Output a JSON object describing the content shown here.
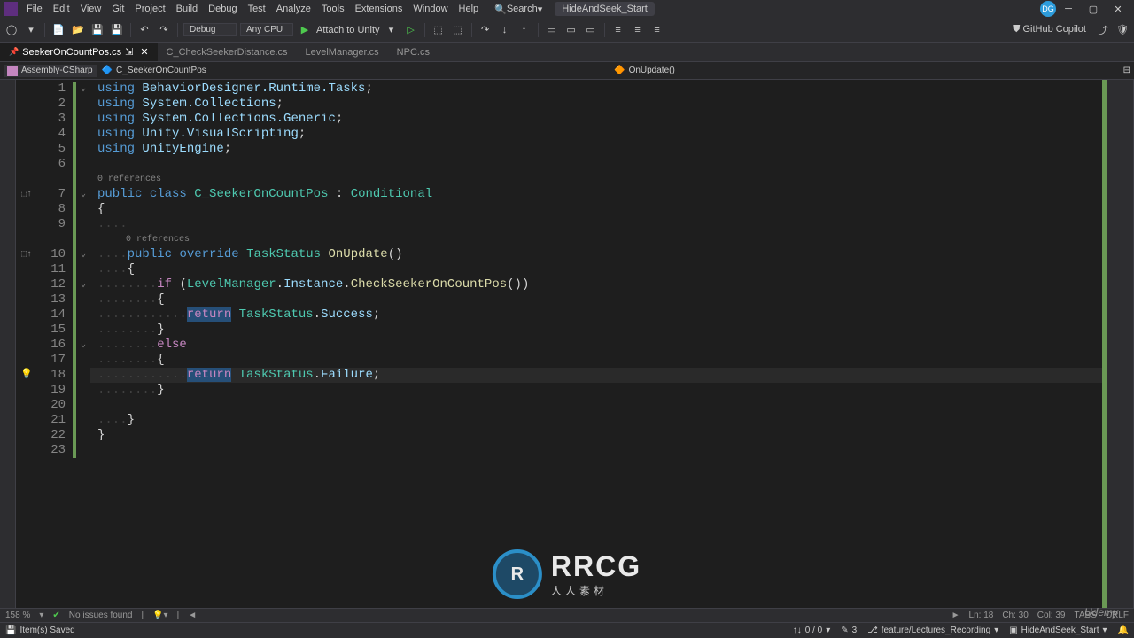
{
  "menu": {
    "items": [
      "File",
      "Edit",
      "View",
      "Git",
      "Project",
      "Build",
      "Debug",
      "Test",
      "Analyze",
      "Tools",
      "Extensions",
      "Window",
      "Help"
    ]
  },
  "search": {
    "label": "Search"
  },
  "solution": {
    "name": "HideAndSeek_Start"
  },
  "avatar": {
    "initials": "DG"
  },
  "toolbar": {
    "config": "Debug",
    "platform": "Any CPU",
    "attach": "Attach to Unity",
    "copilot": "GitHub Copilot"
  },
  "tabs": [
    {
      "name": "SeekerOnCountPos.cs",
      "active": true,
      "pinned": true
    },
    {
      "name": "C_CheckSeekerDistance.cs",
      "active": false,
      "pinned": false
    },
    {
      "name": "LevelManager.cs",
      "active": false,
      "pinned": false
    },
    {
      "name": "NPC.cs",
      "active": false,
      "pinned": false
    }
  ],
  "nav": {
    "assembly": "Assembly-CSharp",
    "type": "C_SeekerOnCountPos",
    "member": "OnUpdate()"
  },
  "codelens": {
    "l7": "0 references",
    "l10": "0 references"
  },
  "tokens": {
    "using": "using",
    "bd": "BehaviorDesigner.Runtime.Tasks",
    "sc": "System.Collections",
    "scg": "System.Collections.Generic",
    "uvs": "Unity.VisualScripting",
    "ue": "UnityEngine",
    "public": "public",
    "class": "class",
    "cls": "C_SeekerOnCountPos",
    "conditional": "Conditional",
    "override": "override",
    "taskstatus": "TaskStatus",
    "onupdate": "OnUpdate",
    "if": "if",
    "else": "else",
    "lm": "LevelManager",
    "inst": "Instance",
    "check": "CheckSeekerOnCountPos",
    "return": "return",
    "succ": "Success",
    "fail": "Failure"
  },
  "bottom": {
    "zoom": "158 %",
    "issues": "No issues found",
    "ln": "Ln: 18",
    "ch": "Ch: 30",
    "col": "Col: 39",
    "tabs": "TABS",
    "crlf": "CRLF"
  },
  "status": {
    "saved": "Item(s) Saved",
    "arrows": "0 / 0",
    "changes": "3",
    "branch": "feature/Lectures_Recording",
    "repo": "HideAndSeek_Start"
  },
  "watermark": {
    "center": "R",
    "big": "RRCG",
    "sub": "人人素材",
    "corner": "Udemy"
  }
}
